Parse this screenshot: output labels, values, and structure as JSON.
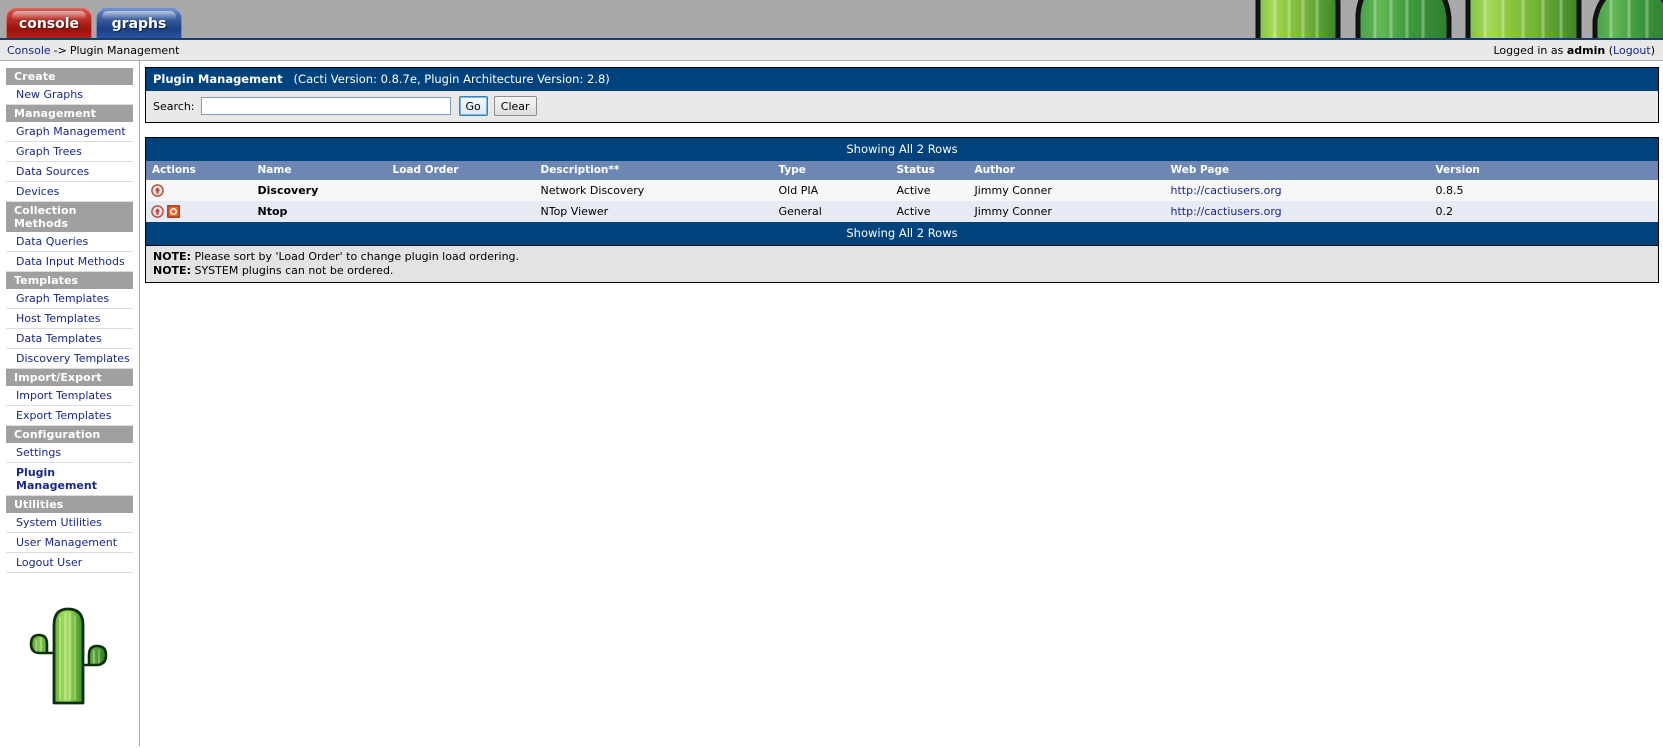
{
  "tabs": [
    {
      "label": "console",
      "name": "tab-console"
    },
    {
      "label": "graphs",
      "name": "tab-graphs"
    }
  ],
  "breadcrumb": {
    "root": "Console",
    "separator": "->",
    "current": "Plugin Management"
  },
  "session": {
    "prefix": "Logged in as",
    "user": "admin",
    "logout_open": "(",
    "logout": "Logout",
    "logout_close": ")"
  },
  "sidebar": {
    "sections": [
      {
        "header": "Create",
        "items": [
          {
            "label": "New Graphs",
            "active": false
          }
        ]
      },
      {
        "header": "Management",
        "items": [
          {
            "label": "Graph Management",
            "active": false
          },
          {
            "label": "Graph Trees",
            "active": false
          },
          {
            "label": "Data Sources",
            "active": false
          },
          {
            "label": "Devices",
            "active": false
          }
        ]
      },
      {
        "header": "Collection Methods",
        "items": [
          {
            "label": "Data Queries",
            "active": false
          },
          {
            "label": "Data Input Methods",
            "active": false
          }
        ]
      },
      {
        "header": "Templates",
        "items": [
          {
            "label": "Graph Templates",
            "active": false
          },
          {
            "label": "Host Templates",
            "active": false
          },
          {
            "label": "Data Templates",
            "active": false
          },
          {
            "label": "Discovery Templates",
            "active": false
          }
        ]
      },
      {
        "header": "Import/Export",
        "items": [
          {
            "label": "Import Templates",
            "active": false
          },
          {
            "label": "Export Templates",
            "active": false
          }
        ]
      },
      {
        "header": "Configuration",
        "items": [
          {
            "label": "Settings",
            "active": false
          },
          {
            "label": "Plugin Management",
            "active": true
          }
        ]
      },
      {
        "header": "Utilities",
        "items": [
          {
            "label": "System Utilities",
            "active": false
          },
          {
            "label": "User Management",
            "active": false
          },
          {
            "label": "Logout User",
            "active": false
          }
        ]
      }
    ],
    "logo_icon": "cactus-logo-icon"
  },
  "panel": {
    "title_main": "Plugin Management",
    "title_sub": "(Cacti Version: 0.8.7e, Plugin Architecture Version: 2.8)"
  },
  "search": {
    "label": "Search:",
    "value": "",
    "placeholder": "",
    "go_label": "Go",
    "clear_label": "Clear"
  },
  "table": {
    "showing_top": "Showing All 2 Rows",
    "showing_bottom": "Showing All 2 Rows",
    "columns": [
      "Actions",
      "Name",
      "Load Order",
      "Description**",
      "Type",
      "Status",
      "Author",
      "Web Page",
      "Version"
    ],
    "rows": [
      {
        "actions": [
          "enable-up-icon"
        ],
        "name": "Discovery",
        "load_order": "",
        "description": "Network Discovery",
        "type": "Old PIA",
        "status": "Active",
        "author": "Jimmy Conner",
        "web_page": "http://cactiusers.org",
        "version": "0.8.5"
      },
      {
        "actions": [
          "enable-up-icon",
          "uninstall-icon"
        ],
        "name": "Ntop",
        "load_order": "",
        "description": "NTop Viewer",
        "type": "General",
        "status": "Active",
        "author": "Jimmy Conner",
        "web_page": "http://cactiusers.org",
        "version": "0.2"
      }
    ]
  },
  "notes": [
    {
      "label": "NOTE:",
      "text": " Please sort by 'Load Order' to change plugin load ordering."
    },
    {
      "label": "NOTE:",
      "text": " SYSTEM plugins can not be ordered."
    }
  ],
  "colors": {
    "header_blue": "#00437c",
    "column_header_blue": "#6d86b4",
    "link": "#182887",
    "banner_gray": "#a9a9a9",
    "nav_header_gray": "#a0a0a0",
    "row_odd": "#f7f7f7",
    "row_even": "#e7ebf5"
  }
}
